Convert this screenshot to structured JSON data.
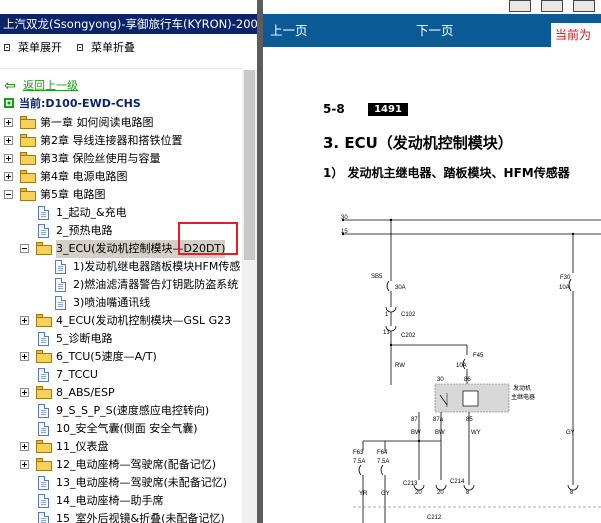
{
  "window": {
    "title": "上汽双龙(Ssongyong)-享御旅行车(KYRON)-200"
  },
  "menu": {
    "expand_label": "菜单展开",
    "collapse_label": "菜单折叠"
  },
  "nav": {
    "back_label": "返回上一级",
    "current_label": "当前:D100-EWD-CHS"
  },
  "tree": [
    {
      "label": "第一章 如何阅读电路图",
      "toggle": "plus",
      "type": "folder",
      "indent": 0
    },
    {
      "label": "第2章 导线连接器和搭铁位置",
      "toggle": "plus",
      "type": "folder",
      "indent": 0
    },
    {
      "label": "第3章 保险丝使用与容量",
      "toggle": "plus",
      "type": "folder",
      "indent": 0
    },
    {
      "label": "第4章 电源电路图",
      "toggle": "plus",
      "type": "folder",
      "indent": 0
    },
    {
      "label": "第5章 电路图",
      "toggle": "minus",
      "type": "folder",
      "indent": 0
    },
    {
      "label": "1_起动_&充电",
      "toggle": "",
      "type": "doc",
      "indent": 1
    },
    {
      "label": "2_预热电路",
      "toggle": "",
      "type": "doc",
      "indent": 1
    },
    {
      "label": "3_ECU(发动机控制模块—D20DT)",
      "toggle": "minus",
      "type": "folder",
      "indent": 1,
      "selected": true
    },
    {
      "label": "1)发动机继电器踏板模块HFM传感",
      "toggle": "",
      "type": "doc",
      "indent": 2
    },
    {
      "label": "2)燃油滤清器警告灯钥匙防盗系统",
      "toggle": "",
      "type": "doc",
      "indent": 2
    },
    {
      "label": "3)喷油嘴通讯线",
      "toggle": "",
      "type": "doc",
      "indent": 2
    },
    {
      "label": "4_ECU(发动机控制模块—GSL G23",
      "toggle": "plus",
      "type": "folder",
      "indent": 1
    },
    {
      "label": "5_诊断电路",
      "toggle": "",
      "type": "doc",
      "indent": 1
    },
    {
      "label": "6_TCU(5速度—A/T)",
      "toggle": "plus",
      "type": "folder",
      "indent": 1
    },
    {
      "label": "7_TCCU",
      "toggle": "",
      "type": "doc",
      "indent": 1
    },
    {
      "label": "8_ABS/ESP",
      "toggle": "plus",
      "type": "folder",
      "indent": 1
    },
    {
      "label": "9_S_S_P_S(速度感应电控转向)",
      "toggle": "",
      "type": "doc",
      "indent": 1
    },
    {
      "label": "10_安全气囊(侧面 安全气囊)",
      "toggle": "",
      "type": "doc",
      "indent": 1
    },
    {
      "label": "11_仪表盘",
      "toggle": "plus",
      "type": "folder",
      "indent": 1
    },
    {
      "label": "12_电动座椅—驾驶席(配备记忆)",
      "toggle": "plus",
      "type": "folder",
      "indent": 1
    },
    {
      "label": "13_电动座椅—驾驶席(未配备记忆)",
      "toggle": "",
      "type": "doc",
      "indent": 1
    },
    {
      "label": "14_电动座椅—助手席",
      "toggle": "",
      "type": "doc",
      "indent": 1
    },
    {
      "label": "15_室外后视镜&折叠(未配备记忆)",
      "toggle": "",
      "type": "doc",
      "indent": 1
    }
  ],
  "content_nav": {
    "prev_label": "上一页",
    "next_label": "下一页",
    "current_label": "当前为"
  },
  "document": {
    "section_number": "5-8",
    "page_badge": "1491",
    "heading": "3. ECU（发动机控制模块）",
    "subheading": "1） 发动机主继电器、踏板模块、HFM传感器"
  },
  "diagram": {
    "wire_30": "30",
    "wire_15": "15",
    "sb5": "SB5",
    "sb5_rating": "30A",
    "f30": "F30",
    "f30_rating": "10A",
    "c102": "C102",
    "c202": "C202",
    "pin1": "1",
    "pin13": "13",
    "f45": "F45",
    "f45_rating": "10A",
    "rw": "RW",
    "relay_label_1": "发动机",
    "relay_label_2": "主继电器",
    "relay_pin30": "30",
    "relay_pin86": "86",
    "relay_pin87": "87",
    "relay_pin87a": "87a",
    "relay_pin85": "85",
    "bw1": "BW",
    "bw2": "BW",
    "wy": "WY",
    "gy1": "GY",
    "f63": "F63",
    "f63_rating": "7.5A",
    "f64": "F64",
    "f64_rating": "7.5A",
    "c213": "C213",
    "c214": "C214",
    "pin20a": "20",
    "pin20b": "20",
    "pin8": "8",
    "pin8c": "8",
    "yr": "YR",
    "gy2": "GY",
    "c212": "C212"
  }
}
